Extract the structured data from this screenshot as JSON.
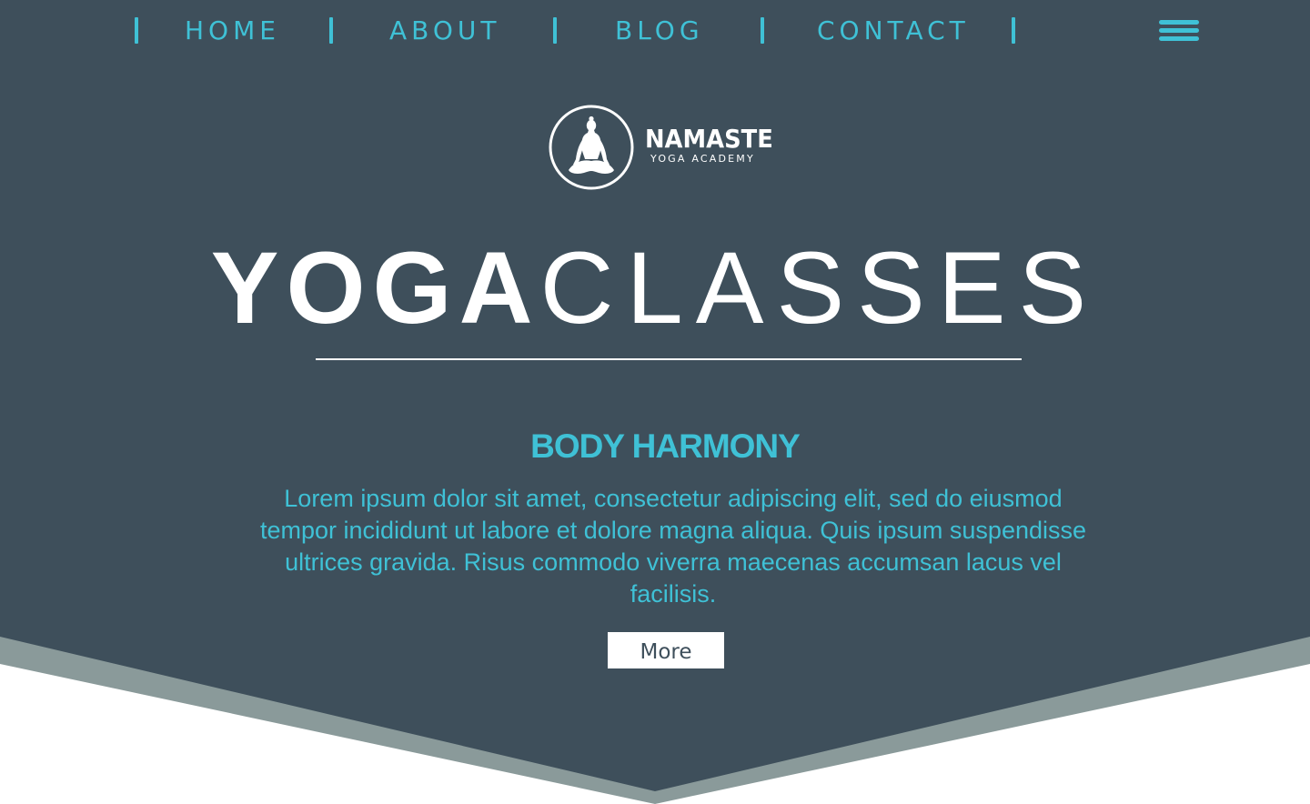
{
  "nav": {
    "items": [
      {
        "label": "HOME"
      },
      {
        "label": "ABOUT"
      },
      {
        "label": "BLOG"
      },
      {
        "label": "CONTACT"
      }
    ],
    "menu_icon": "hamburger-menu-icon"
  },
  "logo": {
    "name": "NAMASTE",
    "tagline": "YOGA ACADEMY",
    "icon": "meditating-figure-icon"
  },
  "hero": {
    "title_bold": "YOGA",
    "title_light": "CLASSES",
    "subtitle": "BODY HARMONY",
    "body": "Lorem ipsum dolor sit amet, consectetur adipiscing elit, sed do eiusmod tempor incididunt ut labore et dolore magna aliqua. Quis ipsum suspendisse ultrices gravida. Risus commodo viverra maecenas accumsan lacus vel facilisis.",
    "button_label": "More"
  },
  "colors": {
    "background_dark": "#3e4f5b",
    "accent": "#3fc1d6",
    "band": "#8a9a9a",
    "white": "#ffffff"
  }
}
